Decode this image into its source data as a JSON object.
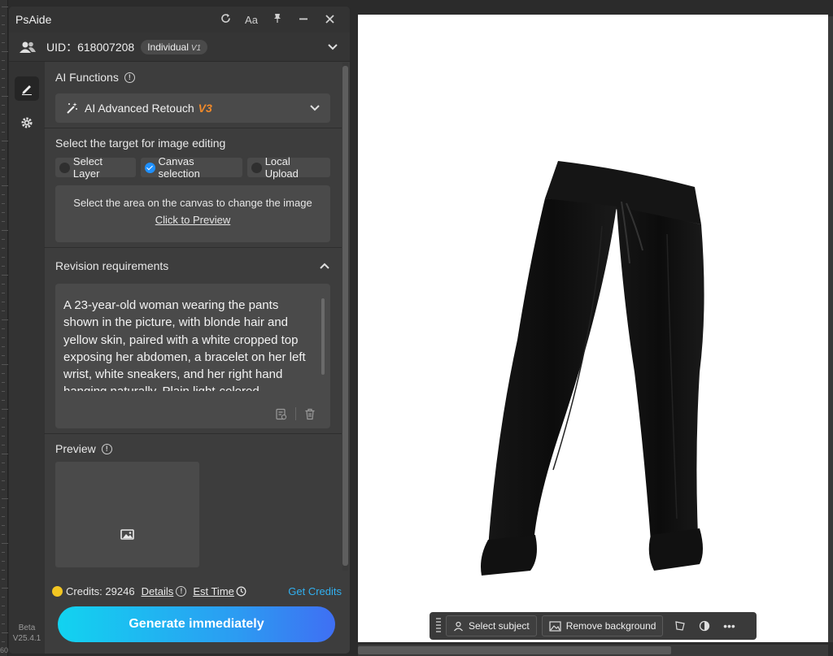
{
  "panel": {
    "title": "PsAide",
    "font_btn": "Aa",
    "uid_label": "UID：618007208",
    "plan": "Individual",
    "plan_tag": "V1"
  },
  "ai_functions": {
    "title": "AI Functions",
    "selected": "AI Advanced Retouch",
    "version": "V3"
  },
  "target": {
    "title": "Select the target for image editing",
    "options": [
      "Select Layer",
      "Canvas selection",
      "Local Upload"
    ],
    "selected": "Canvas selection",
    "hint": "Select the area on the canvas to change the image",
    "preview_link": "Click to Preview"
  },
  "revision": {
    "title": "Revision requirements",
    "text": "A 23-year-old woman wearing the pants shown in the picture, with blonde hair and yellow skin, paired with a white cropped top exposing her abdomen, a bracelet on her left wrist, white sneakers, and her right hand hanging naturally. Plain light-colored background, shown from a"
  },
  "preview": {
    "title": "Preview"
  },
  "footer": {
    "credits": "Credits: 29246",
    "details": "Details",
    "est_time": "Est Time",
    "get_credits": "Get Credits",
    "generate": "Generate immediately",
    "beta": "Beta",
    "version": "V25.4.1"
  },
  "context_bar": {
    "select_subject": "Select subject",
    "remove_background": "Remove background",
    "more": "•••"
  },
  "ruler": {
    "bottom_number": "60"
  }
}
